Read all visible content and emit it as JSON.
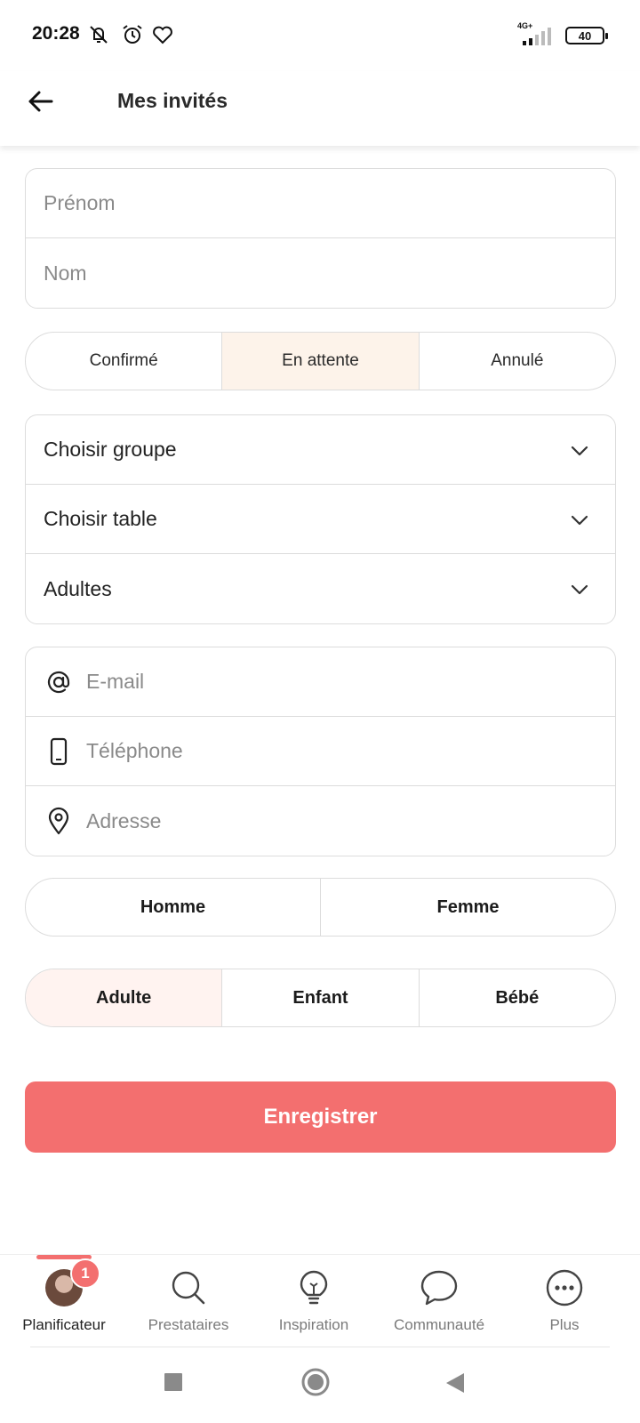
{
  "status_bar": {
    "time": "20:28",
    "network": "4G+",
    "battery": "40",
    "icons": [
      "mute-icon",
      "alarm-icon",
      "heart-icon",
      "signal-icon",
      "battery-icon"
    ]
  },
  "header": {
    "title": "Mes invités",
    "back_icon": "arrow-left-icon"
  },
  "name_fields": {
    "first_name_placeholder": "Prénom",
    "last_name_placeholder": "Nom"
  },
  "rsvp_status": {
    "options": [
      "Confirmé",
      "En attente",
      "Annulé"
    ],
    "selected": "En attente"
  },
  "selects": {
    "group": "Choisir groupe",
    "table": "Choisir table",
    "age_menu": "Adultes"
  },
  "contact_fields": {
    "email_placeholder": "E-mail",
    "phone_placeholder": "Téléphone",
    "address_placeholder": "Adresse"
  },
  "gender": {
    "options": [
      "Homme",
      "Femme"
    ]
  },
  "age_group": {
    "options": [
      "Adulte",
      "Enfant",
      "Bébé"
    ],
    "selected": "Adulte"
  },
  "save_button": "Enregistrer",
  "bottom_nav": {
    "items": [
      {
        "label": "Planificateur",
        "icon": "avatar",
        "badge": "1",
        "active": true
      },
      {
        "label": "Prestataires",
        "icon": "search-icon"
      },
      {
        "label": "Inspiration",
        "icon": "lightbulb-icon"
      },
      {
        "label": "Communauté",
        "icon": "chat-bubble-icon"
      },
      {
        "label": "Plus",
        "icon": "more-icon"
      }
    ]
  },
  "colors": {
    "accent": "#f36f6f",
    "selected_segment": "#fdf3ea",
    "border": "#dcdcdc"
  }
}
